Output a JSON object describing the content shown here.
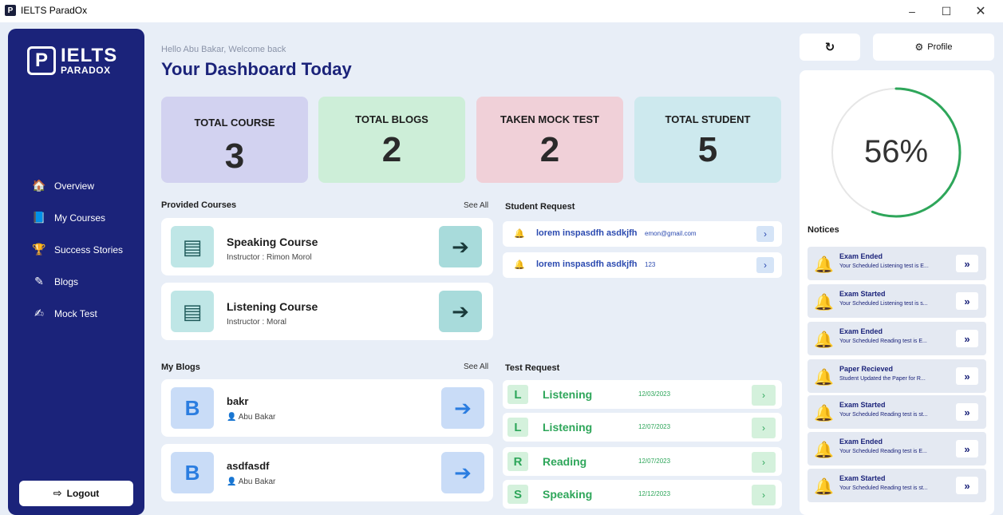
{
  "window": {
    "title": "IELTS ParadOx",
    "app_icon": "P",
    "controls": {
      "minimize": "–",
      "maximize": "☐",
      "close": "✕"
    }
  },
  "colors": {
    "sidebar": "#1b237a",
    "background": "#e8eef7",
    "card_course": "#d2d2f0",
    "card_blogs": "#cdeed8",
    "card_mock": "#f0d0d8",
    "card_student": "#cde9ee",
    "progress": "#2ea65a"
  },
  "sidebar": {
    "logo_mark": "P",
    "logo_main": "IELTS",
    "logo_sub": "PARADOX",
    "items": [
      {
        "icon": "home-icon",
        "glyph": "🏠",
        "label": "Overview"
      },
      {
        "icon": "book-icon",
        "glyph": "📘",
        "label": "My Courses"
      },
      {
        "icon": "trophy-icon",
        "glyph": "🏆",
        "label": "Success Stories"
      },
      {
        "icon": "edit-icon",
        "glyph": "✎",
        "label": "Blogs"
      },
      {
        "icon": "pen-icon",
        "glyph": "✍",
        "label": "Mock Test"
      }
    ],
    "logout_label": "Logout",
    "logout_glyph": "⇨"
  },
  "header": {
    "greeting": "Hello Abu Bakar, Welcome back",
    "title": "Your Dashboard Today"
  },
  "stats": [
    {
      "label": "TOTAL COURSE",
      "value": "3"
    },
    {
      "label": "TOTAL BLOGS",
      "value": "2"
    },
    {
      "label": "TAKEN MOCK TEST",
      "value": "2"
    },
    {
      "label": "TOTAL STUDENT",
      "value": "5"
    }
  ],
  "provided_courses": {
    "heading": "Provided Courses",
    "see_all": "See All",
    "items": [
      {
        "title": "Speaking Course",
        "instructor": "Instructor :  Rimon Morol"
      },
      {
        "title": "Listening Course",
        "instructor": "Instructor :  Moral"
      }
    ]
  },
  "my_blogs": {
    "heading": "My Blogs",
    "see_all": "See All",
    "items": [
      {
        "letter": "B",
        "title": "bakr",
        "author": "Abu Bakar"
      },
      {
        "letter": "B",
        "title": "asdfasdf",
        "author": "Abu Bakar"
      }
    ]
  },
  "student_request": {
    "heading": "Student Request",
    "items": [
      {
        "name": "lorem inspasdfh asdkjfh",
        "detail": "emon@gmail.com"
      },
      {
        "name": "lorem inspasdfh asdkjfh",
        "detail": "123"
      }
    ]
  },
  "test_request": {
    "heading": "Test Request",
    "items": [
      {
        "letter": "L",
        "name": "Listening",
        "date": "12/03/2023"
      },
      {
        "letter": "L",
        "name": "Listening",
        "date": "12/07/2023"
      },
      {
        "letter": "R",
        "name": "Reading",
        "date": "12/07/2023"
      },
      {
        "letter": "S",
        "name": "Speaking",
        "date": "12/12/2023"
      }
    ]
  },
  "right_panel": {
    "refresh_glyph": "↻",
    "profile_label": "Profile",
    "profile_glyph": "⚙",
    "progress_value": 56,
    "progress_text": "56%",
    "notices_heading": "Notices",
    "notices": [
      {
        "title": "Exam Ended",
        "desc": "Your Scheduled Listening test is E..."
      },
      {
        "title": "Exam Started",
        "desc": "Your Scheduled Listening test is s..."
      },
      {
        "title": "Exam Ended",
        "desc": "Your Scheduled Reading test is E..."
      },
      {
        "title": "Paper Recieved",
        "desc": "Student Updated the Paper for R..."
      },
      {
        "title": "Exam Started",
        "desc": "Your Scheduled Reading test is st..."
      },
      {
        "title": "Exam Ended",
        "desc": "Your Scheduled Reading test is E..."
      },
      {
        "title": "Exam Started",
        "desc": "Your Scheduled Reading test is st..."
      }
    ]
  }
}
